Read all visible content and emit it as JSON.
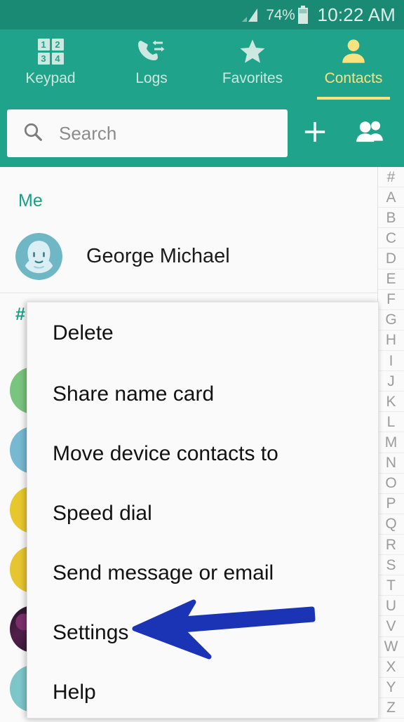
{
  "status_bar": {
    "signal_icon": "signal-bars-icon",
    "battery_percent": "74%",
    "battery_icon": "battery-icon",
    "clock": "10:22 AM"
  },
  "tabs": [
    {
      "label": "Keypad",
      "icon": "keypad-icon",
      "active": false,
      "keys": [
        "1",
        "2",
        "3",
        "4"
      ]
    },
    {
      "label": "Logs",
      "icon": "call-logs-icon",
      "active": false
    },
    {
      "label": "Favorites",
      "icon": "star-icon",
      "active": false
    },
    {
      "label": "Contacts",
      "icon": "person-icon",
      "active": true
    }
  ],
  "search": {
    "placeholder": "Search",
    "value": "",
    "icon": "search-icon",
    "add_icon": "plus-icon",
    "groups_icon": "groups-icon"
  },
  "me_section": {
    "header": "Me",
    "contact_name": "George Michael",
    "avatar_icon": "default-person-avatar"
  },
  "contacts_list": {
    "section_header": "#",
    "rows": [
      {
        "avatar_color": "#79C47E",
        "avatar_type": "color"
      },
      {
        "avatar_color": "#76B9D1",
        "avatar_type": "color"
      },
      {
        "avatar_color": "#E8C72E",
        "avatar_type": "color"
      },
      {
        "avatar_color": "#E6C530",
        "avatar_type": "color"
      },
      {
        "avatar_color": "#3B1B3A",
        "avatar_type": "photo"
      },
      {
        "avatar_color": "#7CC6C9",
        "avatar_type": "color"
      }
    ]
  },
  "index_bar": {
    "items": [
      "#",
      "A",
      "B",
      "C",
      "D",
      "E",
      "F",
      "G",
      "H",
      "I",
      "J",
      "K",
      "L",
      "M",
      "N",
      "O",
      "P",
      "Q",
      "R",
      "S",
      "T",
      "U",
      "V",
      "W",
      "X",
      "Y",
      "Z"
    ]
  },
  "popup_menu": {
    "items": [
      {
        "label": "Delete"
      },
      {
        "label": "Share name card"
      },
      {
        "label": "Move device contacts to"
      },
      {
        "label": "Speed dial"
      },
      {
        "label": "Send message or email"
      },
      {
        "label": "Settings"
      },
      {
        "label": "Help"
      }
    ]
  },
  "annotation": {
    "arrow_icon": "left-arrow-annotation",
    "arrow_color": "#1B34B5",
    "points_to": "Settings"
  },
  "colors": {
    "status_bar_bg": "#1A8A74",
    "app_bar_bg": "#1FA38B",
    "accent_yellow": "#FAE27E",
    "accent_teal": "#16A085",
    "content_bg": "#FAFAFA"
  }
}
